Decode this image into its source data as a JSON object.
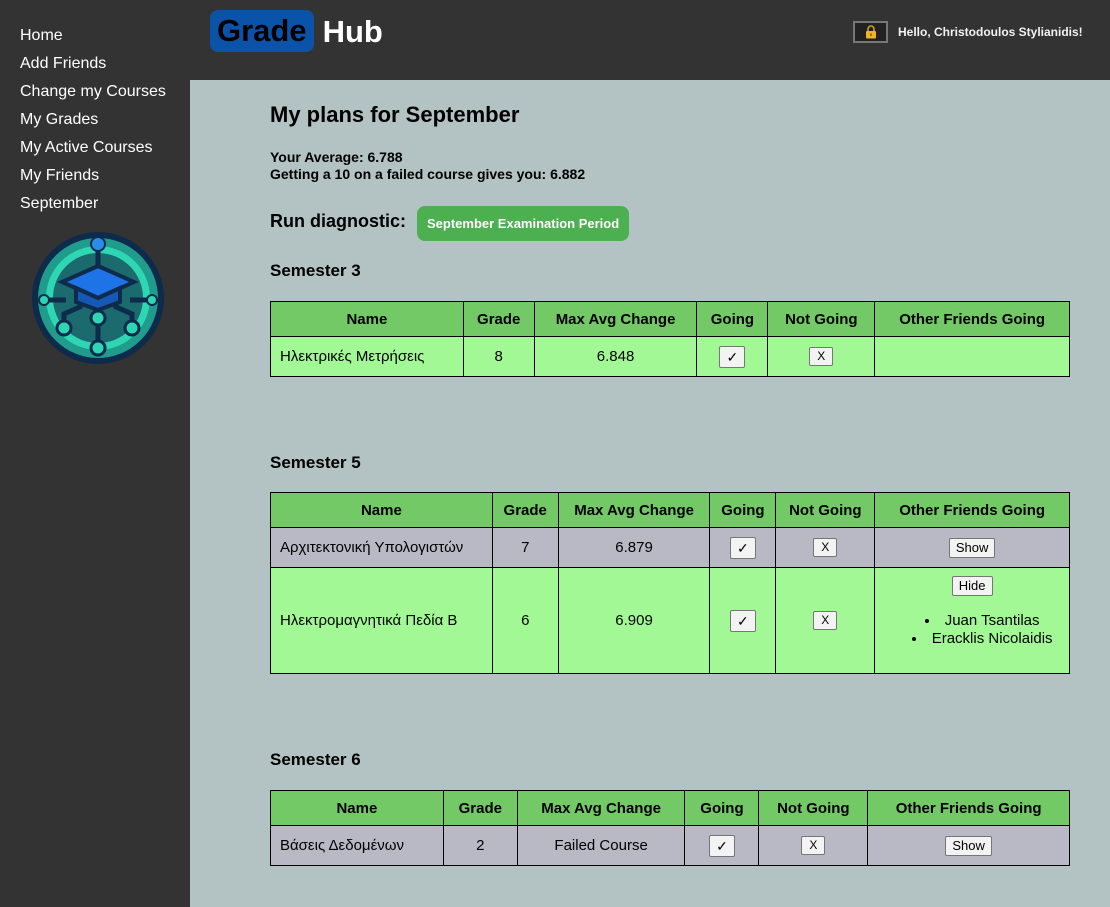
{
  "sidebar": {
    "items": [
      {
        "label": "Home"
      },
      {
        "label": "Add Friends"
      },
      {
        "label": "Change my Courses"
      },
      {
        "label": "My Grades"
      },
      {
        "label": "My Active Courses"
      },
      {
        "label": "My Friends"
      },
      {
        "label": "September"
      }
    ],
    "logo_icon": "graduation-cap-circuit-logo"
  },
  "header": {
    "brand_grade": "Grade",
    "brand_hub": "Hub",
    "lock_icon": "lock-icon",
    "greeting": "Hello, Christodoulos Stylianidis!"
  },
  "page": {
    "title": "My plans for September",
    "average_line": "Your Average: 6.788",
    "improve_line": "Getting a 10 on a failed course gives you: 6.882",
    "diagnostic_label": "Run diagnostic:",
    "diagnostic_button": "September Examination Period"
  },
  "table_headers": [
    "Name",
    "Grade",
    "Max Avg Change",
    "Going",
    "Not Going",
    "Other Friends Going"
  ],
  "controls": {
    "going": "✓",
    "not_going": "X",
    "show": "Show",
    "hide": "Hide"
  },
  "semesters": [
    {
      "title": "Semester 3",
      "rows": [
        {
          "name": "Ηλεκτρικές Μετρήσεις",
          "grade": "8",
          "max_avg_change": "6.848"
        }
      ]
    },
    {
      "title": "Semester 5",
      "rows": [
        {
          "name": "Αρχιτεκτονική Υπολογιστών",
          "grade": "7",
          "max_avg_change": "6.879"
        },
        {
          "name": "Ηλεκτρομαγνητικά Πεδία Β",
          "grade": "6",
          "max_avg_change": "6.909",
          "friends": [
            "Juan Tsantilas",
            "Eracklis Nicolaidis"
          ]
        }
      ]
    },
    {
      "title": "Semester 6",
      "rows": [
        {
          "name": "Βάσεις Δεδομένων",
          "grade": "2",
          "max_avg_change": "Failed Course"
        }
      ]
    }
  ],
  "colors": {
    "sidebar_bg": "#333333",
    "page_bg": "#b3c2c2",
    "header_row": "#72c965",
    "row_green": "#a2f895",
    "row_gray": "#b9b9c6",
    "accent_button": "#4caf50",
    "brand_blue": "#0a53a8"
  }
}
